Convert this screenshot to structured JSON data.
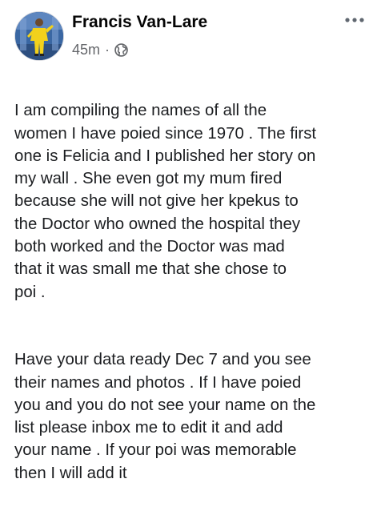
{
  "post": {
    "author": "Francis Van-Lare",
    "time": "45m",
    "separator": "·",
    "privacy_icon": "globe-icon",
    "more_icon": "more-options-icon",
    "paragraphs": [
      "I am compiling the names of all the\nwomen I have poied since 1970 . The first\none is Felicia and I published her story on\nmy wall  . She even got my mum fired\nbecause she will not give her kpekus to\nthe Doctor who owned the hospital they\nboth worked and the Doctor was mad\nthat it was small me that she chose to\npoi .",
      "Have your data ready Dec 7 and you see\ntheir names and photos . If I have poied\nyou and you do not see your name on the\nlist please inbox me to edit it and add\nyour name . If your poi was memorable\nthen I will add it"
    ]
  },
  "colors": {
    "author": "#050505",
    "meta": "#65676b",
    "text": "#1c1e21",
    "avatar_bg": "#3d6aa8",
    "avatar_suit": "#f2d11c"
  }
}
